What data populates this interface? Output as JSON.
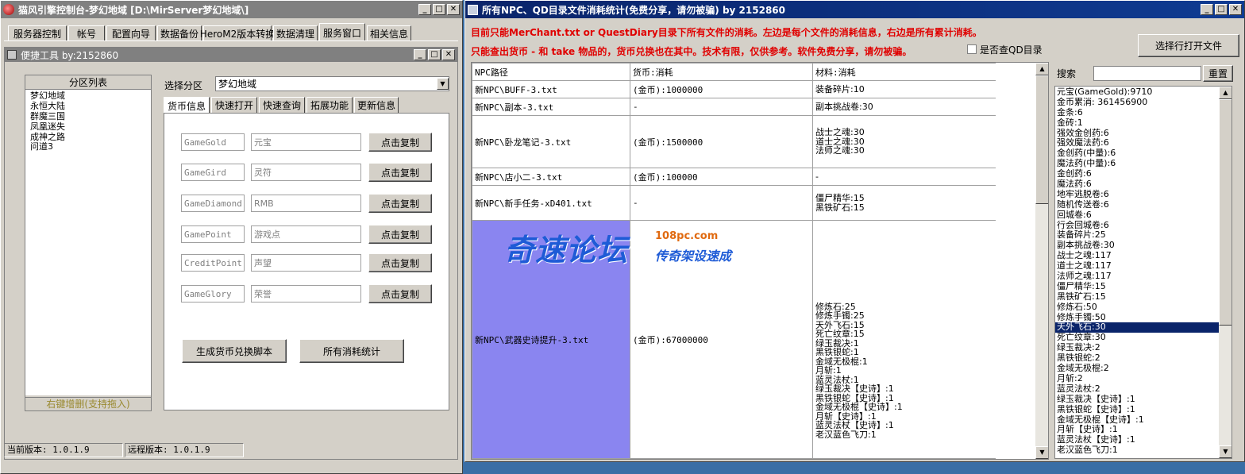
{
  "left_window": {
    "title": "猫风引擎控制台-梦幻地域 [D:\\MirServer梦幻地域\\]",
    "menu_tabs": [
      "服务器控制",
      "帐号",
      "配置向导",
      "数据备份",
      "HeroM2版本转换",
      "数据清理",
      "服务窗口",
      "相关信息"
    ],
    "inner_title": "便捷工具   by:2152860",
    "partition_list_header": "分区列表",
    "partition_items": [
      "梦幻地域",
      "永恒大陆",
      "群魔三国",
      "凤凰迷失",
      "成神之路",
      "问道3"
    ],
    "partition_footer": "右键增删(支持拖入)",
    "select_partition_label": "选择分区",
    "select_partition_value": "梦幻地域",
    "sub_tabs": [
      "货币信息",
      "快速打开",
      "快速查询",
      "拓展功能",
      "更新信息"
    ],
    "currencies": [
      {
        "code": "GameGold",
        "name": "元宝",
        "button": "点击复制"
      },
      {
        "code": "GameGird",
        "name": "灵符",
        "button": "点击复制"
      },
      {
        "code": "GameDiamond",
        "name": "RMB",
        "button": "点击复制"
      },
      {
        "code": "GamePoint",
        "name": "游戏点",
        "button": "点击复制"
      },
      {
        "code": "CreditPoint",
        "name": "声望",
        "button": "点击复制"
      },
      {
        "code": "GameGlory",
        "name": "荣誉",
        "button": "点击复制"
      }
    ],
    "gen_script_button": "生成货币兑换脚本",
    "all_stats_button": "所有消耗统计",
    "status_current": "当前版本: 1.0.1.9",
    "status_remote": "远程版本: 1.0.1.9"
  },
  "right_window": {
    "title": "所有NPC、QD目录文件消耗统计(免费分享，请勿被骗)     by 2152860",
    "notice_line1": "目前只能MerChant.txt or QuestDiary目录下所有文件的消耗。左边是每个文件的消耗信息，右边是所有累计消耗。",
    "notice_line2": "只能查出货币 - 和 take 物品的，货币兑换也在其中。技术有限，仅供参考。软件免费分享，请勿被骗。",
    "checkbox_label": "是否查QD目录",
    "open_file_button": "选择行打开文件",
    "search_label": "搜索",
    "search_value": "",
    "reset_button": "重置",
    "table_headers": [
      "NPC路径",
      "货币:消耗",
      "材料:消耗"
    ],
    "table_rows": [
      {
        "path": "新NPC\\BUFF-3.txt",
        "currency": "(金币):1000000",
        "materials": [
          "装备碎片:10"
        ]
      },
      {
        "path": "新NPC\\副本-3.txt",
        "currency": "-",
        "materials": [
          "副本挑战卷:30"
        ]
      },
      {
        "path": "新NPC\\卧龙笔记-3.txt",
        "currency": "(金币):1500000",
        "materials": [
          "战士之魂:30",
          "道士之魂:30",
          "法师之魂:30"
        ]
      },
      {
        "path": "新NPC\\店小二-3.txt",
        "currency": "(金币):100000",
        "materials": [
          "-"
        ]
      },
      {
        "path": "新NPC\\新手任务-xD401.txt",
        "currency": "-",
        "materials": [
          "僵尸精华:15",
          "黑铁矿石:15"
        ]
      },
      {
        "path": "新NPC\\武器史诗提升-3.txt",
        "currency": "(金币):67000000",
        "materials": [
          "修炼石:25",
          "修炼手镯:25",
          "天外飞石:15",
          "死亡纹章:15",
          "绿玉裁决:1",
          "黑铁银蛇:1",
          "金域无极棍:1",
          "月斩:1",
          "蓝灵法杖:1",
          "绿玉裁决【史诗】:1",
          "黑铁银蛇【史诗】:1",
          "金域无极棍【史诗】:1",
          "月斩【史诗】:1",
          "蓝灵法杖【史诗】:1",
          "老汉蓝色飞刀:1"
        ]
      }
    ],
    "totals": [
      "元宝(GameGold):9710",
      "金币累消: 361456900",
      "金条:6",
      "金砖:1",
      "强效金创药:6",
      "强效魔法药:6",
      "金创药(中量):6",
      "魔法药(中量):6",
      "金创药:6",
      "魔法药:6",
      "地牢逃脱卷:6",
      "随机传送卷:6",
      "回城卷:6",
      "行会回城卷:6",
      "装备碎片:25",
      "副本挑战卷:30",
      "战士之魂:117",
      "道士之魂:117",
      "法师之魂:117",
      "僵尸精华:15",
      "黑铁矿石:15",
      "修炼石:50",
      "修炼手镯:50",
      "天外飞石:30",
      "死亡纹章:30",
      "绿玉裁决:2",
      "黑铁银蛇:2",
      "金域无极棍:2",
      "月斩:2",
      "蓝灵法杖:2",
      "绿玉裁决【史诗】:1",
      "黑铁银蛇【史诗】:1",
      "金域无极棍【史诗】:1",
      "月斩【史诗】:1",
      "蓝灵法杖【史诗】:1",
      "老汉蓝色飞刀:1"
    ],
    "selected_total_index": 23
  },
  "watermark": {
    "main": "奇速论坛",
    "site": "108pc.com",
    "slogan": "传奇架设速成"
  },
  "colors": {
    "titlebar_active": "#0a246a",
    "titlebar_inactive": "#808080",
    "notice_red": "#e00000",
    "selection": "#0a246a",
    "row_highlight": "#8a85f0",
    "watermark_blue": "#1e5bd6"
  }
}
